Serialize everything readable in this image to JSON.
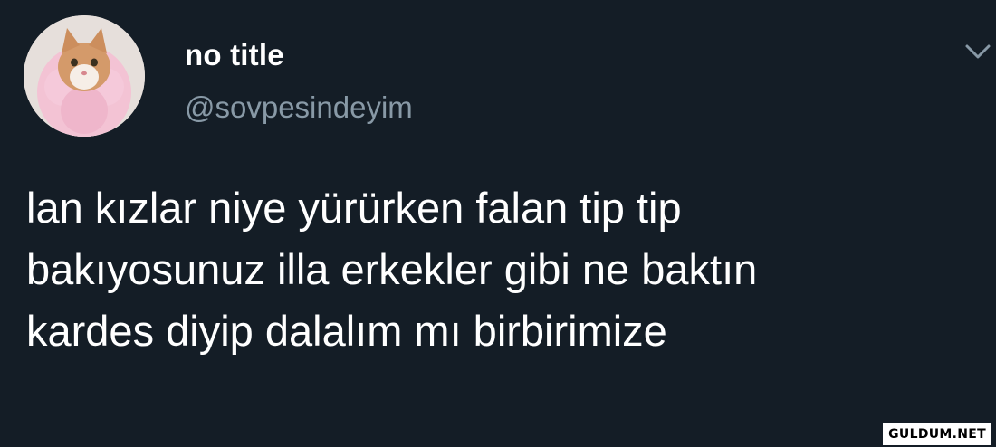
{
  "user": {
    "display_name": "no title",
    "handle": "@sovpesindeyim",
    "avatar_icon": "cat-in-pink-tutu-avatar"
  },
  "menu": {
    "icon": "chevron-down-icon"
  },
  "tweet": {
    "lines": [
      "lan kızlar niye yürürken falan tip tip",
      "bakıyosunuz illa erkekler gibi ne baktın",
      "kardes diyip dalalım mı birbirimize"
    ]
  },
  "watermark": {
    "text": "GULDUM.NET"
  },
  "colors": {
    "background": "#141d26",
    "text": "#ffffff",
    "secondary_text": "#8899a6",
    "caret": "#8899a6"
  }
}
